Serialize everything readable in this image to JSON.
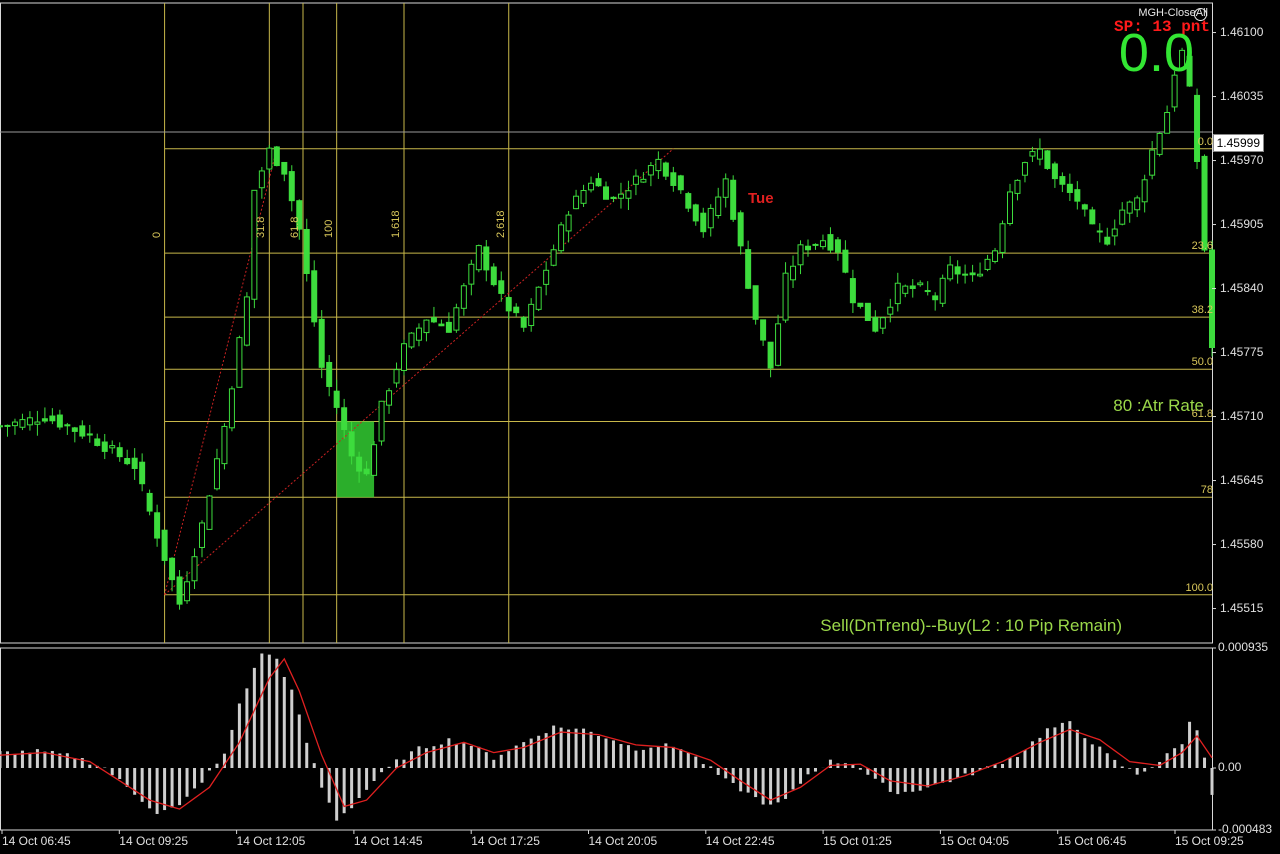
{
  "hud": {
    "title": "MGH-CloseAll",
    "icon": "frown-icon",
    "spread": "SP: 13 pnt",
    "profit": "0.0"
  },
  "labels": {
    "atr": "80 :Atr Rate",
    "signal": "Sell(DnTrend)--Buy(L2 : 10 Pip Remain)",
    "marker": "Tue"
  },
  "current_price": "1.45999",
  "chart_data": [
    {
      "type": "candlestick",
      "title": "",
      "ylim": [
        1.4548,
        1.4613
      ],
      "y_ticks": [
        "1.46100",
        "1.46035",
        "1.45970",
        "1.45905",
        "1.45840",
        "1.45775",
        "1.45710",
        "1.45645",
        "1.45580",
        "1.45515"
      ],
      "x_ticks": [
        "14 Oct 06:45",
        "14 Oct 09:25",
        "14 Oct 12:05",
        "14 Oct 14:45",
        "14 Oct 17:25",
        "14 Oct 20:05",
        "14 Oct 22:45",
        "15 Oct 01:25",
        "15 Oct 04:05",
        "15 Oct 06:45",
        "15 Oct 09:25"
      ],
      "close_path": [
        [
          0,
          1.457
        ],
        [
          6,
          1.4571
        ],
        [
          12,
          1.4569
        ],
        [
          18,
          1.4566
        ],
        [
          21,
          1.4559
        ],
        [
          24,
          1.4552
        ],
        [
          27,
          1.456
        ],
        [
          30,
          1.457
        ],
        [
          33,
          1.4583
        ],
        [
          34,
          1.4594
        ],
        [
          36,
          1.4598
        ],
        [
          38,
          1.4596
        ],
        [
          40,
          1.459
        ],
        [
          43,
          1.4576
        ],
        [
          45,
          1.4572
        ],
        [
          47,
          1.4567
        ],
        [
          49,
          1.4565
        ],
        [
          51,
          1.4572
        ],
        [
          54,
          1.4578
        ],
        [
          57,
          1.4581
        ],
        [
          60,
          1.458
        ],
        [
          62,
          1.4584
        ],
        [
          64,
          1.4588
        ],
        [
          67,
          1.4583
        ],
        [
          70,
          1.458
        ],
        [
          73,
          1.4586
        ],
        [
          76,
          1.4592
        ],
        [
          79,
          1.4595
        ],
        [
          82,
          1.4593
        ],
        [
          85,
          1.4595
        ],
        [
          88,
          1.4597
        ],
        [
          91,
          1.4594
        ],
        [
          94,
          1.459
        ],
        [
          97,
          1.4595
        ],
        [
          99,
          1.4588
        ],
        [
          101,
          1.4581
        ],
        [
          103,
          1.4576
        ],
        [
          105,
          1.4585
        ],
        [
          107,
          1.4588
        ],
        [
          110,
          1.4589
        ],
        [
          112,
          1.4588
        ],
        [
          114,
          1.4583
        ],
        [
          117,
          1.458
        ],
        [
          120,
          1.4584
        ],
        [
          123,
          1.4584
        ],
        [
          125,
          1.4583
        ],
        [
          127,
          1.4586
        ],
        [
          130,
          1.4585
        ],
        [
          133,
          1.4588
        ],
        [
          135,
          1.4594
        ],
        [
          137,
          1.4597
        ],
        [
          139,
          1.4598
        ],
        [
          141,
          1.4595
        ],
        [
          144,
          1.4593
        ],
        [
          146,
          1.459
        ],
        [
          148,
          1.4589
        ],
        [
          150,
          1.4592
        ],
        [
          152,
          1.4593
        ],
        [
          154,
          1.4598
        ],
        [
          156,
          1.4602
        ],
        [
          157,
          1.4606
        ],
        [
          158,
          1.4608
        ],
        [
          159,
          1.4604
        ],
        [
          160,
          1.4597
        ],
        [
          161,
          1.4588
        ],
        [
          162,
          1.4578
        ]
      ],
      "hlines": [
        {
          "price": 1.45999,
          "color": "#9a9a9a"
        }
      ],
      "fibonacci_horizontal": {
        "labels": [
          "0.0",
          "23.6",
          "38.2",
          "50.0",
          "61.8",
          "78",
          "100.0"
        ],
        "prices": [
          1.45982,
          1.45876,
          1.45811,
          1.45758,
          1.45705,
          1.45628,
          1.45529
        ]
      },
      "fibonacci_time": {
        "labels": [
          "0",
          "31.8",
          "61.8",
          "100",
          "1.618",
          "2.618"
        ],
        "bars": [
          22,
          36,
          40.5,
          45,
          54,
          68
        ]
      },
      "zone": {
        "from_bar": 45,
        "to_bar": 50,
        "top": 1.45705,
        "bottom": 1.45628,
        "color": "#33cc33"
      }
    },
    {
      "type": "histogram",
      "title": "",
      "ylim": [
        -0.000483,
        0.000935
      ],
      "y_ticks": [
        "0.000935",
        "0.00",
        "-0.000483"
      ],
      "histogram_path": [
        [
          0,
          0.00012
        ],
        [
          5,
          0.00013
        ],
        [
          10,
          9e-05
        ],
        [
          14,
          0.0
        ],
        [
          18,
          -0.0002
        ],
        [
          21,
          -0.00035
        ],
        [
          24,
          -0.0003
        ],
        [
          27,
          -0.0001
        ],
        [
          30,
          0.0001
        ],
        [
          32,
          0.0005
        ],
        [
          35,
          0.0009
        ],
        [
          37,
          0.00085
        ],
        [
          39,
          0.0006
        ],
        [
          41,
          0.0002
        ],
        [
          43,
          -0.00015
        ],
        [
          45,
          -0.0004
        ],
        [
          47,
          -0.0003
        ],
        [
          50,
          -0.0001
        ],
        [
          53,
          5e-05
        ],
        [
          56,
          0.00015
        ],
        [
          60,
          0.00022
        ],
        [
          63,
          0.00018
        ],
        [
          66,
          8e-05
        ],
        [
          70,
          0.0002
        ],
        [
          74,
          0.00032
        ],
        [
          78,
          0.0003
        ],
        [
          82,
          0.00022
        ],
        [
          85,
          0.00015
        ],
        [
          88,
          0.00018
        ],
        [
          91,
          0.00016
        ],
        [
          94,
          4e-05
        ],
        [
          97,
          -0.0001
        ],
        [
          100,
          -0.0002
        ],
        [
          103,
          -0.0003
        ],
        [
          105,
          -0.00025
        ],
        [
          108,
          -5e-05
        ],
        [
          111,
          5e-05
        ],
        [
          114,
          4e-05
        ],
        [
          117,
          -0.0001
        ],
        [
          120,
          -0.0002
        ],
        [
          124,
          -0.00015
        ],
        [
          128,
          -8e-05
        ],
        [
          132,
          0.0
        ],
        [
          136,
          0.0001
        ],
        [
          140,
          0.0003
        ],
        [
          143,
          0.00035
        ],
        [
          146,
          0.0002
        ],
        [
          149,
          5e-05
        ],
        [
          152,
          -5e-05
        ],
        [
          155,
          5e-05
        ],
        [
          158,
          0.0002
        ],
        [
          159,
          0.00035
        ],
        [
          160,
          0.0003
        ],
        [
          161,
          0.0001
        ],
        [
          162,
          -0.0002
        ]
      ],
      "signal_path": [
        [
          0,
          0.0001
        ],
        [
          6,
          0.00012
        ],
        [
          12,
          5e-05
        ],
        [
          16,
          -0.0001
        ],
        [
          20,
          -0.00025
        ],
        [
          24,
          -0.00032
        ],
        [
          28,
          -0.00015
        ],
        [
          32,
          0.0002
        ],
        [
          36,
          0.0007
        ],
        [
          38,
          0.00085
        ],
        [
          40,
          0.0006
        ],
        [
          43,
          0.0001
        ],
        [
          46,
          -0.0003
        ],
        [
          49,
          -0.00025
        ],
        [
          53,
          0.0
        ],
        [
          57,
          0.00012
        ],
        [
          62,
          0.0002
        ],
        [
          66,
          0.00012
        ],
        [
          70,
          0.00016
        ],
        [
          75,
          0.00028
        ],
        [
          80,
          0.00026
        ],
        [
          85,
          0.00018
        ],
        [
          90,
          0.00016
        ],
        [
          95,
          6e-05
        ],
        [
          99,
          -0.0001
        ],
        [
          103,
          -0.00025
        ],
        [
          107,
          -0.00015
        ],
        [
          111,
          2e-05
        ],
        [
          115,
          3e-05
        ],
        [
          119,
          -0.0001
        ],
        [
          124,
          -0.00014
        ],
        [
          129,
          -6e-05
        ],
        [
          134,
          5e-05
        ],
        [
          139,
          0.0002
        ],
        [
          143,
          0.0003
        ],
        [
          147,
          0.00022
        ],
        [
          151,
          5e-05
        ],
        [
          155,
          2e-05
        ],
        [
          158,
          0.00012
        ],
        [
          160,
          0.00025
        ],
        [
          162,
          8e-05
        ]
      ]
    }
  ]
}
